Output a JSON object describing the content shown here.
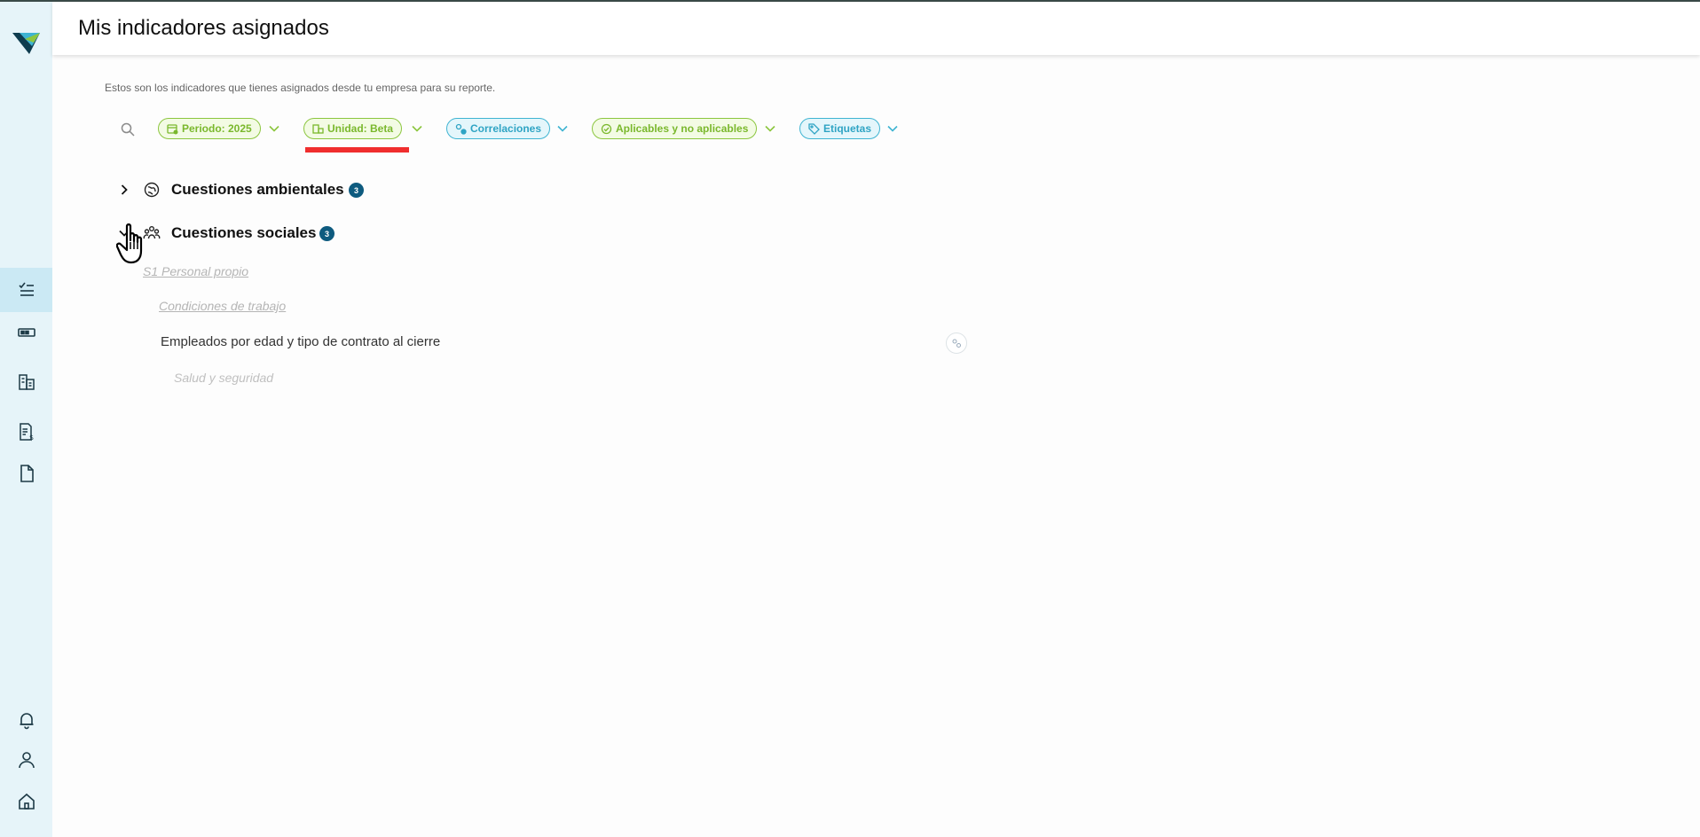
{
  "header": {
    "title": "Mis indicadores asignados"
  },
  "intro": {
    "text": "Estos son los indicadores que tienes asignados desde tu empresa para su reporte."
  },
  "filters": {
    "periodo": "Periodo: 2025",
    "unidad": "Unidad: Beta",
    "correlaciones": "Correlaciones",
    "aplicables": "Aplicables y no aplicables",
    "etiquetas": "Etiquetas"
  },
  "tree": {
    "groups": [
      {
        "label": "Cuestiones ambientales",
        "count": "3",
        "expanded": false
      },
      {
        "label": "Cuestiones sociales",
        "count": "3",
        "expanded": true
      }
    ],
    "social": {
      "section": "S1 Personal propio",
      "subsection": "Condiciones de trabajo",
      "indicator": "Empleados por edad y tipo de contrato al cierre",
      "next_subsection": "Salud y seguridad"
    }
  },
  "colors": {
    "accent_green": "#8cc63f",
    "accent_blue": "#3fb4d2",
    "badge": "#0e5b7f",
    "sidebar": "#e6f4f9",
    "highlight_red": "#f02e2e"
  },
  "icons": {
    "sidebar": [
      "checklist-icon",
      "card-icon",
      "buildings-icon",
      "invoice-icon",
      "document-icon",
      "bell-icon",
      "user-icon",
      "home-icon"
    ]
  }
}
